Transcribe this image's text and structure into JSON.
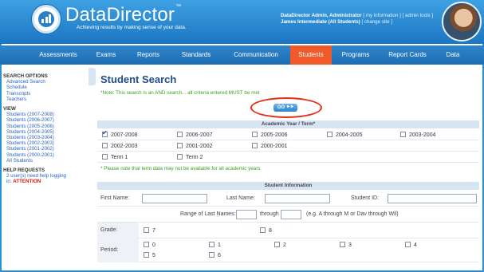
{
  "header": {
    "brand": "DataDirector",
    "trademark": "™",
    "tagline": "Achieving results by making sense of your data.",
    "user_name": "DataDirector Admin, Administrator",
    "my_info": "[ my information ]",
    "admin_tools": "[ admin tools ]",
    "site": "James Intermediate (All Students)",
    "change_site": "[ change site ]"
  },
  "nav": [
    "Assessments",
    "Exams",
    "Reports",
    "Standards",
    "Communication",
    "Students",
    "Programs",
    "Report Cards",
    "Data"
  ],
  "nav_active": "Students",
  "sidebar": {
    "search_options_head": "SEARCH OPTIONS",
    "search_links": [
      "Advanced Search",
      "Schedule",
      "Transcripts",
      "Teachers"
    ],
    "view_head": "VIEW",
    "view_links": [
      "Students (2007-2008)",
      "Students (2006-2007)",
      "Students (2005-2006)",
      "Students (2004-2005)",
      "Students (2003-2004)",
      "Students (2002-2003)",
      "Students (2001-2002)",
      "Students (2000-2001)",
      "All Students"
    ],
    "help_head": "HELP REQUESTS",
    "help_text_1": "2 user(s) need help logging",
    "help_text_2": "in:",
    "help_attention": "ATTENTION"
  },
  "main": {
    "title": "Student Search",
    "note": "*Note: This search is an AND search... all criteria entered MUST be met",
    "go_label": "GO ⯈⯈",
    "year_section": "Academic Year / Term*",
    "years_row1": [
      "2007-2008",
      "2006-2007",
      "2005-2006",
      "2004-2005",
      "2003-2004"
    ],
    "years_row2": [
      "2002-2003",
      "2001-2002",
      "2000-2001"
    ],
    "terms": [
      "Term 1",
      "Term 2"
    ],
    "checked_year": "2007-2008",
    "term_note": "* Please note that term data may not be available for all academic years",
    "student_section": "Student Information",
    "first_name_label": "First Name:",
    "last_name_label": "Last Name:",
    "student_id_label": "Student ID:",
    "range_label": "Range of Last Names:",
    "through_label": "through",
    "range_example": "(e.g. A through M or Dav through Wil)",
    "grade_label": "Grade:",
    "grades": [
      "7",
      "8"
    ],
    "period_label": "Period:",
    "periods_row1": [
      "0",
      "1",
      "2",
      "3",
      "4"
    ],
    "periods_row2": [
      "5",
      "6"
    ]
  }
}
